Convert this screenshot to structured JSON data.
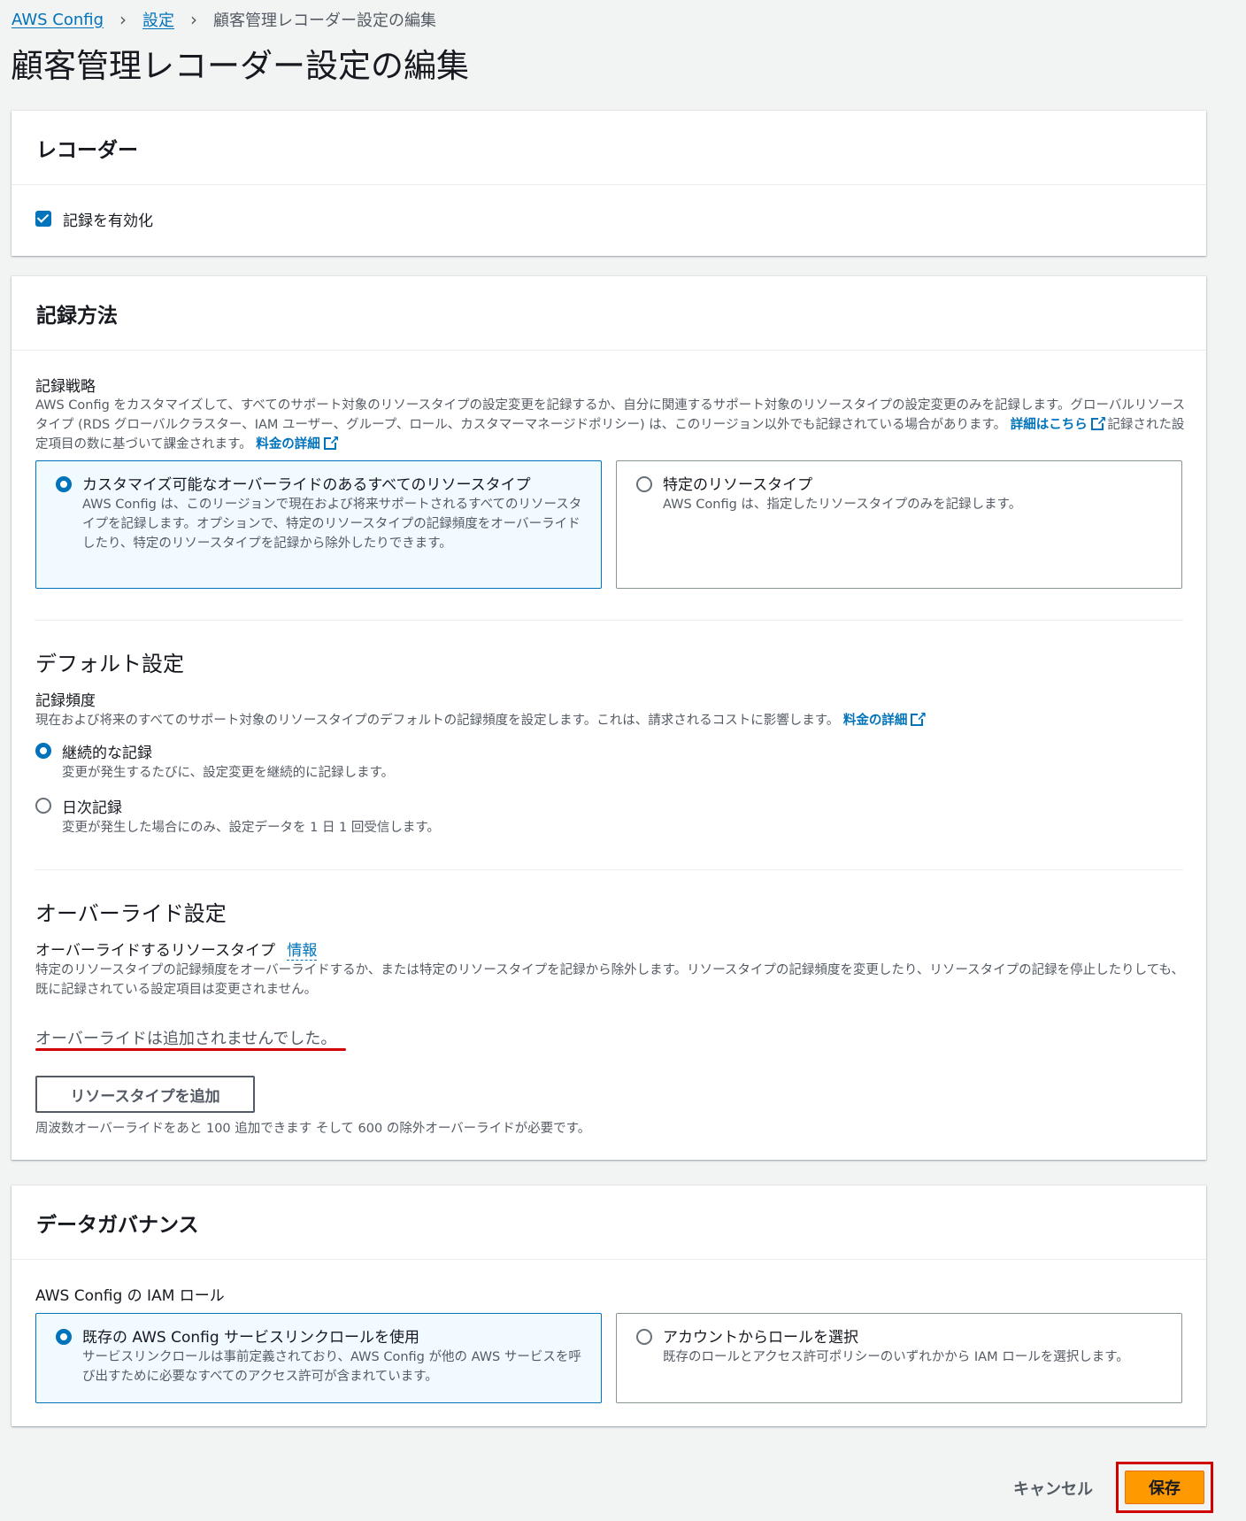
{
  "breadcrumb": {
    "items": [
      "AWS Config",
      "設定"
    ],
    "current": "顧客管理レコーダー設定の編集"
  },
  "page": {
    "title": "顧客管理レコーダー設定の編集"
  },
  "recorder": {
    "heading": "レコーダー",
    "enable_label": "記録を有効化",
    "enabled": true
  },
  "method": {
    "heading": "記録方法",
    "strategy_label": "記録戦略",
    "strategy_desc": "AWS Config をカスタマイズして、すべてのサポート対象のリソースタイプの設定変更を記録するか、自分に関連するサポート対象のリソースタイプの設定変更のみを記録します。グローバルリソースタイプ (RDS グローバルクラスター、IAM ユーザー、グループ、ロール、カスタマーマネージドポリシー) は、このリージョン以外でも記録されている場合があります。",
    "details_link": "詳細はこちら",
    "billing_text": "記録された設定項目の数に基づいて課金されます。",
    "pricing_link": "料金の詳細",
    "options": [
      {
        "title": "カスタマイズ可能なオーバーライドのあるすべてのリソースタイプ",
        "desc": "AWS Config は、このリージョンで現在および将来サポートされるすべてのリソースタイプを記録します。オプションで、特定のリソースタイプの記録頻度をオーバーライドしたり、特定のリソースタイプを記録から除外したりできます。",
        "selected": true
      },
      {
        "title": "特定のリソースタイプ",
        "desc": "AWS Config は、指定したリソースタイプのみを記録します。",
        "selected": false
      }
    ]
  },
  "defaults": {
    "heading": "デフォルト設定",
    "freq_label": "記録頻度",
    "freq_desc": "現在および将来のすべてのサポート対象のリソースタイプのデフォルトの記録頻度を設定します。これは、請求されるコストに影響します。",
    "pricing_link": "料金の詳細",
    "options": [
      {
        "title": "継続的な記録",
        "desc": "変更が発生するたびに、設定変更を継続的に記録します。",
        "selected": true
      },
      {
        "title": "日次記録",
        "desc": "変更が発生した場合にのみ、設定データを 1 日 1 回受信します。",
        "selected": false
      }
    ]
  },
  "overrides": {
    "heading": "オーバーライド設定",
    "label": "オーバーライドするリソースタイプ",
    "info_link": "情報",
    "desc": "特定のリソースタイプの記録頻度をオーバーライドするか、または特定のリソースタイプを記録から除外します。リソースタイプの記録頻度を変更したり、リソースタイプの記録を停止したりしても、既に記録されている設定項目は変更されません。",
    "empty_text": "オーバーライドは追加されませんでした。",
    "add_button": "リソースタイプを追加",
    "limit_text": "周波数オーバーライドをあと 100 追加できます そして 600 の除外オーバーライドが必要です。"
  },
  "governance": {
    "heading": "データガバナンス",
    "role_label": "AWS Config の IAM ロール",
    "options": [
      {
        "title": "既存の AWS Config サービスリンクロールを使用",
        "desc": "サービスリンクロールは事前定義されており、AWS Config が他の AWS サービスを呼び出すために必要なすべてのアクセス許可が含まれています。",
        "selected": true
      },
      {
        "title": "アカウントからロールを選択",
        "desc": "既存のロールとアクセス許可ポリシーのいずれかから IAM ロールを選択します。",
        "selected": false
      }
    ]
  },
  "footer": {
    "cancel": "キャンセル",
    "save": "保存"
  },
  "colors": {
    "accent": "#0073bb",
    "primary_button": "#ff9900",
    "highlight": "#d10000"
  }
}
